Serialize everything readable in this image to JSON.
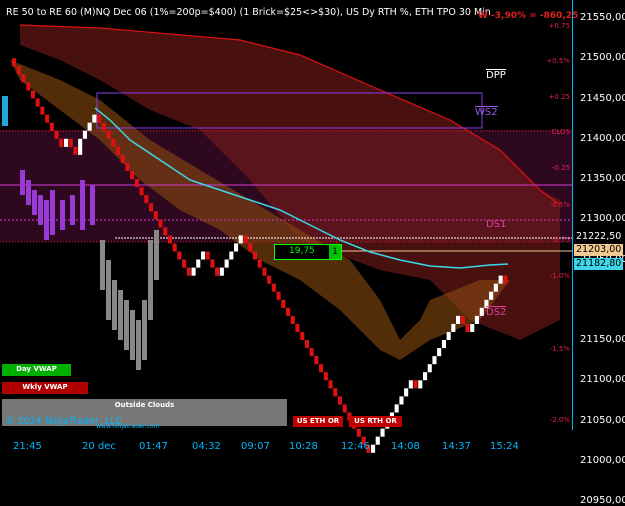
{
  "header": {
    "title": "RE 50 to RE 60 (M)NQ Dec 06 (1%=200p=$400) (1 Brick=$25<>$30), US Dy RTH %, ETH TPO 30 Min",
    "pnl": "W -3,90% = -860,25"
  },
  "price_axis": {
    "labels": [
      "21550,00",
      "21500,00",
      "21450,00",
      "21400,00",
      "21350,00",
      "21300,00",
      "21250,00",
      "21150,00",
      "21100,00",
      "21050,00",
      "21000,00",
      "20950,00"
    ],
    "current_price": "21222,50",
    "level_a": "21203,00",
    "level_b": "21182,80"
  },
  "percent_levels": [
    "+0.75",
    "+0.5%",
    "+0.25",
    "CLOS",
    "-0.25",
    "-0.5%",
    "-0.75",
    "-1.0%",
    "-1.5%",
    "-2.0%"
  ],
  "time_axis": [
    "21:45",
    "20 dec",
    "01:47",
    "04:32",
    "09:07",
    "10:28",
    "12:46",
    "14:08",
    "14:37",
    "15:24"
  ],
  "zones": {
    "dpp": "DPP",
    "ws2": "WS2",
    "ds1": "DS1",
    "ds2": "DS2"
  },
  "position_box": {
    "value": "19,75",
    "qty": "1"
  },
  "buttons": {
    "day_vwap": "Day VWAP",
    "wkly_vwap": "Wkly VWAP",
    "outside_clouds": "Outside Clouds",
    "us_eth_or": "US ETH OR",
    "us_rth_or": "US RTH OR"
  },
  "footer": {
    "copyright": "© 2024 NinjaTrader, LLC",
    "url": "www.ninjatrader.com"
  },
  "colors": {
    "up_brick": "#ffffff",
    "down_brick": "#e01010",
    "vwap_line": "#3fd6e8",
    "cloud_upper": "#7a1a1a",
    "cloud_lower": "#8a4a10",
    "magenta": "#d43ad4",
    "axis": "#00b7ff"
  },
  "chart_data": {
    "type": "line",
    "title": "",
    "bricks_close": [
      21490,
      21480,
      21470,
      21460,
      21450,
      21440,
      21430,
      21420,
      21410,
      21400,
      21390,
      21400,
      21390,
      21380,
      21400,
      21410,
      21420,
      21430,
      21420,
      21410,
      21400,
      21390,
      21380,
      21370,
      21360,
      21350,
      21340,
      21330,
      21320,
      21310,
      21300,
      21290,
      21280,
      21270,
      21260,
      21250,
      21240,
      21230,
      21240,
      21250,
      21260,
      21250,
      21240,
      21230,
      21240,
      21250,
      21260,
      21270,
      21280,
      21270,
      21260,
      21250,
      21240,
      21230,
      21220,
      21210,
      21200,
      21190,
      21180,
      21170,
      21160,
      21150,
      21140,
      21130,
      21120,
      21110,
      21100,
      21090,
      21080,
      21070,
      21060,
      21050,
      21040,
      21030,
      21020,
      21010,
      21020,
      21030,
      21040,
      21050,
      21060,
      21070,
      21080,
      21090,
      21100,
      21090,
      21100,
      21110,
      21120,
      21130,
      21140,
      21150,
      21160,
      21170,
      21180,
      21170,
      21160,
      21170,
      21180,
      21190,
      21200,
      21210,
      21220,
      21230,
      21220
    ]
  }
}
